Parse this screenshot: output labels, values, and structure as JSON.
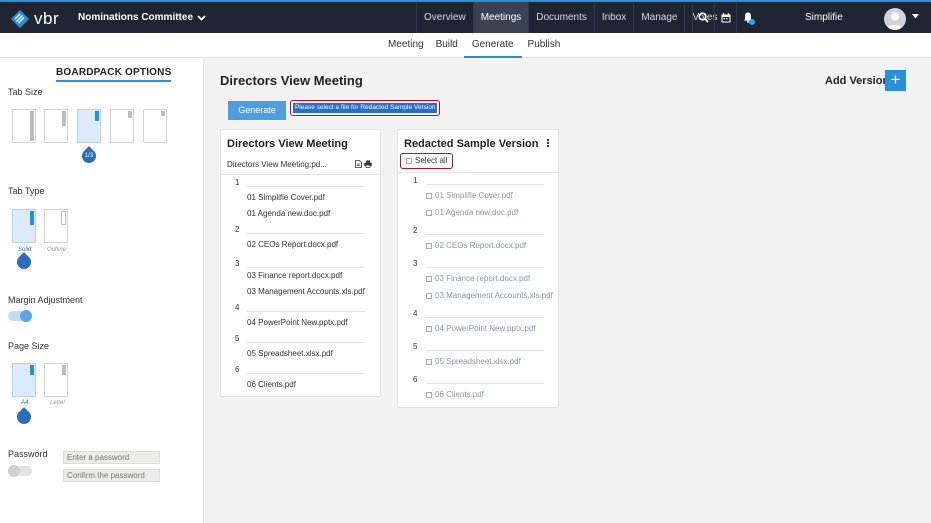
{
  "header": {
    "logo_text": "vbr",
    "committee": "Nominations Committee",
    "nav": [
      "Overview",
      "Meetings",
      "Documents",
      "Inbox",
      "Manage",
      "Votes"
    ],
    "active_nav": "Meetings",
    "username": "Simplifie"
  },
  "subnav": {
    "items": [
      "Meeting",
      "Build",
      "Generate",
      "Publish"
    ],
    "active": "Generate"
  },
  "sidebar": {
    "title": "BOARDPACK OPTIONS",
    "tab_size_label": "Tab Size",
    "tab_size_badge": "1/3",
    "tab_type_label": "Tab Type",
    "tab_type_options": [
      "Solid",
      "Outline"
    ],
    "margin_label": "Margin Adjustment",
    "margin_on": true,
    "page_size_label": "Page Size",
    "page_size_options": [
      "A4",
      "Letter"
    ],
    "password_label": "Password",
    "password_on": false,
    "password_placeholder": "Enter a password",
    "confirm_placeholder": "Confirm the password"
  },
  "main": {
    "title": "Directors View Meeting",
    "add_version": "Add Version",
    "generate_button": "Generate",
    "notice": "Please select a file for Redacted Sample Version"
  },
  "left_panel": {
    "title": "Directors View Meeting",
    "file": "Directors View Meeting.pd...",
    "groups": [
      {
        "num": "1",
        "items": [
          "01 Simplifie Cover.pdf",
          "01 Agenda new.doc.pdf"
        ]
      },
      {
        "num": "2",
        "items": [
          "02 CEOs Report.docx.pdf"
        ]
      },
      {
        "num": "3",
        "items": [
          "03 Finance report.docx.pdf",
          "03 Management Accounts.xls.pdf"
        ]
      },
      {
        "num": "4",
        "items": [
          "04 PowerPoint New.pptx.pdf"
        ]
      },
      {
        "num": "5",
        "items": [
          "05 Spreadsheet.xlsx.pdf"
        ]
      },
      {
        "num": "6",
        "items": [
          "06 Clients.pdf"
        ]
      }
    ]
  },
  "right_panel": {
    "title": "Redacted Sample Version",
    "select_all": "Select all",
    "groups": [
      {
        "num": "1",
        "items": [
          "01 Simplifie Cover.pdf",
          "01 Agenda new.doc.pdf"
        ]
      },
      {
        "num": "2",
        "items": [
          "02 CEOs Report.docx.pdf"
        ]
      },
      {
        "num": "3",
        "items": [
          "03 Finance report.docx.pdf",
          "03 Management Accounts.xls.pdf"
        ]
      },
      {
        "num": "4",
        "items": [
          "04 PowerPoint New.pptx.pdf"
        ]
      },
      {
        "num": "5",
        "items": [
          "05 Spreadsheet.xlsx.pdf"
        ]
      },
      {
        "num": "6",
        "items": [
          "06 Clients.pdf"
        ]
      }
    ]
  },
  "colors": {
    "accent": "#2b8fd6",
    "topbar": "#1f2533",
    "highlight": "#b0142a"
  }
}
